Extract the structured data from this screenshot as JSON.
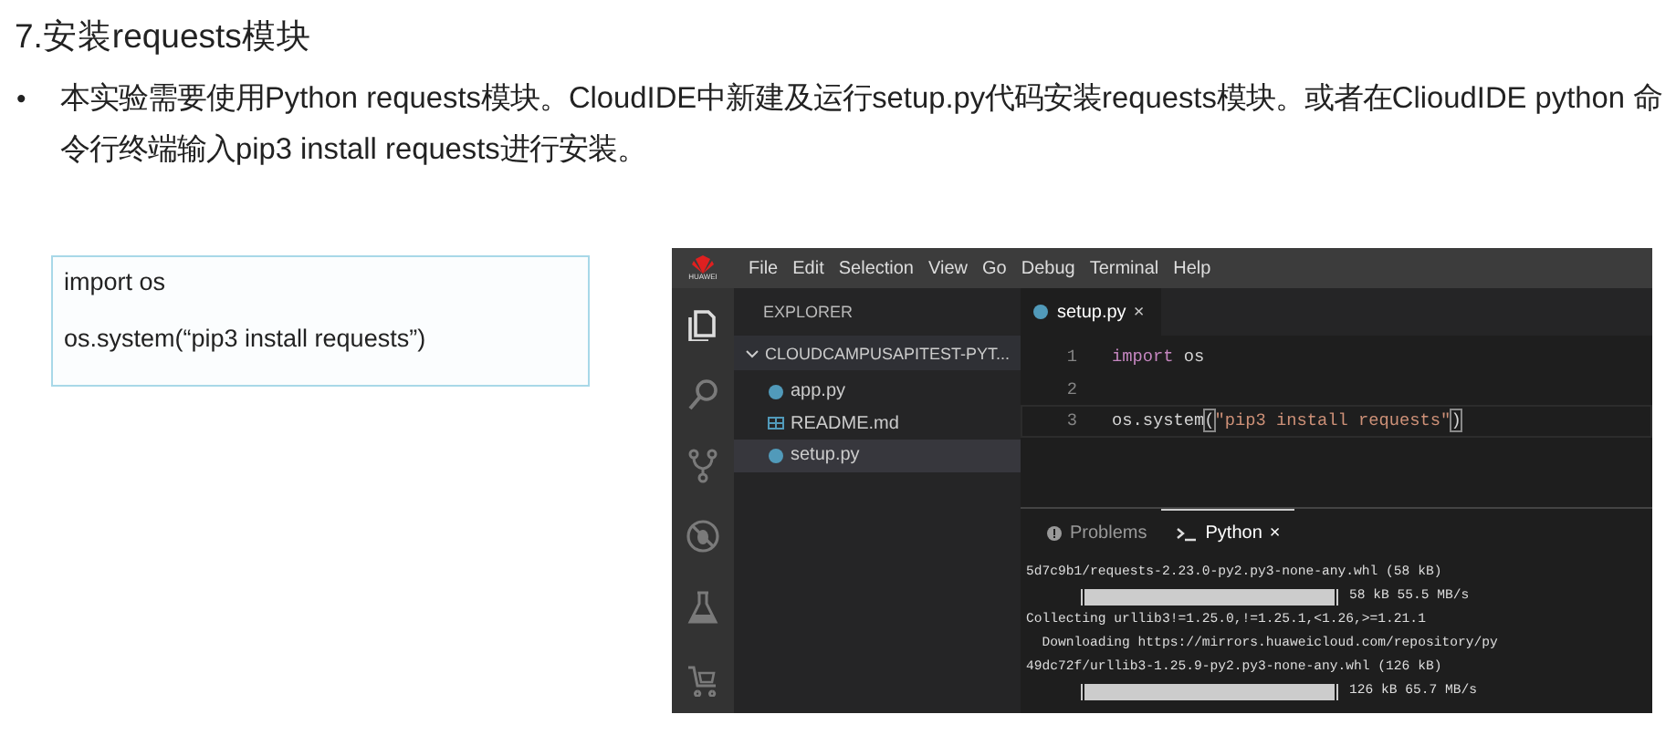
{
  "heading": "7.安装requests模块",
  "bullet": {
    "marker": "•",
    "text": "本实验需要使用Python requests模块。CloudIDE中新建及运行setup.py代码安装requests模块。或者在ClioudIDE python 命令行终端输入pip3 install requests进行安装。"
  },
  "code_box": {
    "lines": [
      "import os",
      "os.system(“pip3 install requests”)"
    ]
  },
  "ide": {
    "logo_text": "HUAWEI",
    "menu": [
      "File",
      "Edit",
      "Selection",
      "View",
      "Go",
      "Debug",
      "Terminal",
      "Help"
    ],
    "activity": [
      {
        "kind": "files",
        "selected": true
      },
      {
        "kind": "search",
        "selected": false
      },
      {
        "kind": "branch",
        "selected": false
      },
      {
        "kind": "debug",
        "selected": false
      },
      {
        "kind": "flask",
        "selected": false
      },
      {
        "kind": "cart",
        "selected": false
      }
    ],
    "explorer": {
      "title": "EXPLORER",
      "folder": {
        "label": "CLOUDCAMPUSAPITEST-PYT...",
        "expanded": true
      },
      "files": [
        {
          "name": "app.py",
          "kind": "python",
          "selected": false
        },
        {
          "name": "README.md",
          "kind": "markdown",
          "selected": false
        },
        {
          "name": "setup.py",
          "kind": "python",
          "selected": true
        }
      ]
    },
    "editor": {
      "tab": {
        "label": "setup.py",
        "close": "×"
      },
      "lines": [
        {
          "number": "1",
          "tokens": [
            {
              "kind": "keyword",
              "text": "import"
            },
            {
              "kind": "plain",
              "text": " os"
            }
          ]
        },
        {
          "number": "2"
        },
        {
          "number": "3",
          "tokens": [
            {
              "kind": "plain",
              "text": "os.system"
            },
            {
              "kind": "bracket",
              "text": "("
            },
            {
              "kind": "string",
              "text": "\"pip3 install requests\""
            },
            {
              "kind": "bracket",
              "text": ")"
            }
          ]
        }
      ]
    },
    "panel": {
      "tabs": [
        {
          "label": "Problems",
          "kind": "problems",
          "selected": false
        },
        {
          "label": "Python",
          "kind": "terminal",
          "selected": true,
          "close": "×"
        }
      ],
      "terminal": [
        {
          "kind": "text",
          "text": "5d7c9b1/requests-2.23.0-py2.py3-none-any.whl (58 kB)"
        },
        {
          "kind": "progress",
          "level": 1,
          "reading": "58 kB 55.5 MB/s"
        },
        {
          "kind": "text",
          "text": "Collecting urllib3!=1.25.0,!=1.25.1,<1.26,>=1.21.1"
        },
        {
          "kind": "text",
          "text": "  Downloading https://mirrors.huaweicloud.com/repository/py"
        },
        {
          "kind": "text",
          "text": "49dc72f/urllib3-1.25.9-py2.py3-none-any.whl (126 kB)"
        },
        {
          "kind": "progress",
          "level": 1,
          "reading": "126 kB 65.7 MB/s"
        }
      ]
    }
  }
}
